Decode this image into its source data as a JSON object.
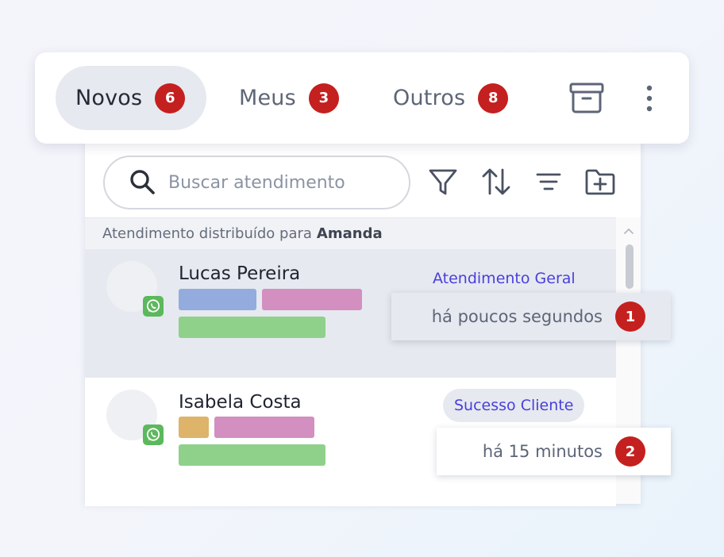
{
  "colors": {
    "accent_badge": "#c4201f",
    "queue_text": "#4a3fdc",
    "active_bg": "#e6e9ef",
    "whatsapp": "#4caf50"
  },
  "tabs": [
    {
      "label": "Novos",
      "count": "6",
      "active": true
    },
    {
      "label": "Meus",
      "count": "3",
      "active": false
    },
    {
      "label": "Outros",
      "count": "8",
      "active": false
    }
  ],
  "header_icons": {
    "archive": "archive-icon",
    "more": "more-vertical-icon"
  },
  "search": {
    "placeholder": "Buscar atendimento",
    "value": ""
  },
  "toolbar_icons": [
    "filter-icon",
    "sort-icon",
    "list-filter-icon",
    "folder-add-icon"
  ],
  "distributed": {
    "prefix": "Atendimento distribuído para",
    "name": "Amanda"
  },
  "conversations": [
    {
      "name": "Lucas Pereira",
      "channel_icon": "whatsapp-icon",
      "queue": "Atendimento Geral",
      "time": "há poucos segundos",
      "order": "1",
      "tag_colors": [
        "#93acdd",
        "#d38fbf",
        "#8fd18a"
      ]
    },
    {
      "name": "Isabela Costa",
      "channel_icon": "whatsapp-icon",
      "queue": "Sucesso Cliente",
      "time": "há 15 minutos",
      "order": "2",
      "tag_colors": [
        "#ddb46a",
        "#d38fbf",
        "#8fd18a"
      ]
    }
  ]
}
